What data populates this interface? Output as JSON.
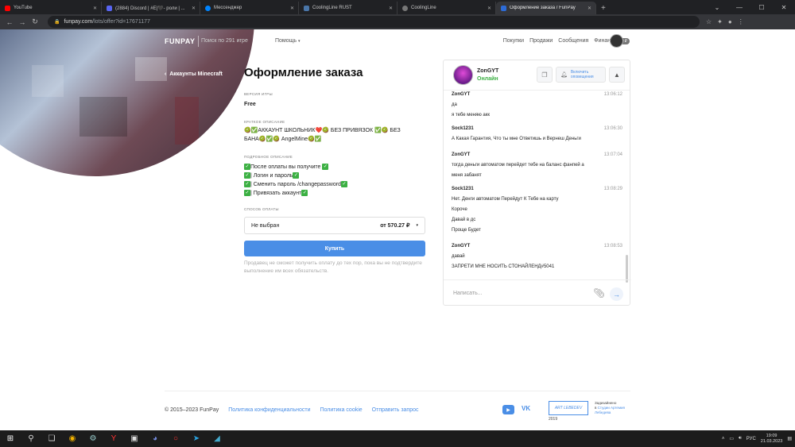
{
  "browser": {
    "tabs": [
      {
        "title": "YouTube",
        "color": "#ff0000"
      },
      {
        "title": "(2884) Discord | #E|🖤- роли | ...",
        "color": "#5865f2"
      },
      {
        "title": "Мессенджер",
        "color": "#0084ff"
      },
      {
        "title": "CoolingLine RUST",
        "color": "#4a76a8"
      },
      {
        "title": "CoolingLine",
        "color": "#777777"
      },
      {
        "title": "Оформление заказа / FunPay",
        "color": "#2d6bd6",
        "active": true
      }
    ],
    "new_tab": "+",
    "url_host": "funpay.com",
    "url_path": "/lots/offer?id=17671177"
  },
  "header": {
    "logo": "FUNPAY",
    "search_placeholder": "Поиск по 291 игре",
    "help": "Помощь",
    "nav": [
      "Покупки",
      "Продажи",
      "Сообщения",
      "Финансы"
    ],
    "finance_badge": "0 ₽"
  },
  "breadcrumb": "Аккаунты Minecraft",
  "order": {
    "title": "Оформление заказа",
    "version_label": "ВЕРСИЯ ИГРЫ",
    "version": "Free",
    "short_label": "КРАТКОЕ ОПИСАНИЕ",
    "short_line1": "🥝✅АККАУНТ ШКОЛЬНИК❤️🥝 БЕЗ ПРИВЯЗОК ✅🥝 БЕЗ",
    "short_line2": "БАНА🥝✅🥝 AngelMine🥝✅",
    "detail_label": "ПОДРОБНОЕ ОПИСАНИЕ",
    "details": [
      "После оплаты вы получите",
      "| Логин и пароль",
      "| Сменить пароль /changepassword",
      "| Привязать аккаунт"
    ],
    "payment_label": "СПОСОБ ОПЛАТЫ",
    "payment_value": "Не выбран",
    "price": "от 570.27 ₽",
    "buy": "Купить",
    "note": "Продавец не сможет получить оплату до тех пор, пока вы не подтвердите выполнение им всех обязательств."
  },
  "chat": {
    "name": "ZonGYT",
    "status": "Онлайн",
    "notify_line1": "Включить",
    "notify_line2": "оповещения",
    "messages": [
      {
        "who": "ZonGYT",
        "time": "13:06:12",
        "lines": [
          "да",
          "я тебе меняю акк"
        ]
      },
      {
        "who": "Sock1231",
        "time": "13:06:30",
        "lines": [
          "А Какая Гарантия, Что ты мне Ответишь и Вернеш Деньги"
        ]
      },
      {
        "who": "ZonGYT",
        "time": "13:07:04",
        "lines": [
          "тогда деньги автоматом перейдет тебе на баланс фанпей а",
          "меня забанят"
        ]
      },
      {
        "who": "Sock1231",
        "time": "13:08:29",
        "lines": [
          "Нет. Денги автоматом Перейдут К Тебе на карту",
          "Короче",
          "Давай в дс",
          "Проще Будет"
        ]
      },
      {
        "who": "ZonGYT",
        "time": "13:08:53",
        "lines": [
          "давай",
          "ЗАПРЕТИ МНЕ НОСИТЬ СТОНАЙЛЕНД#5041"
        ]
      }
    ],
    "input_placeholder": "Написать..."
  },
  "footer": {
    "copyright": "© 2015–2023 FunPay",
    "links": [
      "Политика конфиденциальности",
      "Политика cookie",
      "Отправить запрос"
    ],
    "art_logo": "ART LEBEDEV",
    "art_year": "2019",
    "made_line1": "Задизайнено",
    "made_line2": "в",
    "made_link1": "Студии Артемия",
    "made_link2": "Лебедева"
  },
  "taskbar": {
    "lang": "РУС",
    "time": "19:09",
    "date": "21.03.2023"
  }
}
